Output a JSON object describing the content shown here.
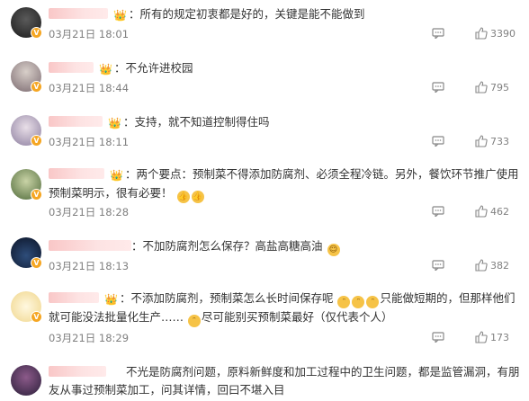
{
  "comments": [
    {
      "text": "：所有的规定初衷都是好的，关键是能不能做到",
      "time": "03月21日 18:01",
      "likes": "3390"
    },
    {
      "text": "：不允许进校园",
      "time": "03月21日 18:44",
      "likes": "795"
    },
    {
      "text": "：支持，就不知道控制得住吗",
      "time": "03月21日 18:11",
      "likes": "733"
    },
    {
      "text": "：两个要点：预制菜不得添加防腐剂、必须全程冷链。另外，餐饮环节推广使用预制菜明示，很有必要！",
      "time": "03月21日 18:28",
      "likes": "462"
    },
    {
      "text": "：不加防腐剂怎么保存？高盐高糖高油",
      "time": "03月21日 18:13",
      "likes": "382"
    },
    {
      "text_a": "：不添加防腐剂，预制菜怎么长时间保存呢",
      "text_b": "只能做短期的，但那样他们就可能没法批量化生产……",
      "text_c": "尽可能别买预制菜最好（仅代表个人）",
      "time": "03月21日 18:29",
      "likes": "173"
    },
    {
      "text": "不光是防腐剂问题，原料新鲜度和加工过程中的卫生问题，都是监管漏洞，有朋友从事过预制菜加工，问其详情，回曰不堪入目"
    }
  ],
  "colors": {
    "accent": "#f5a623",
    "meta": "#808080",
    "text": "#333333"
  },
  "icons": {
    "reply": "comment-icon",
    "like": "thumbs-up-icon",
    "emoji": "smile-emoji"
  }
}
